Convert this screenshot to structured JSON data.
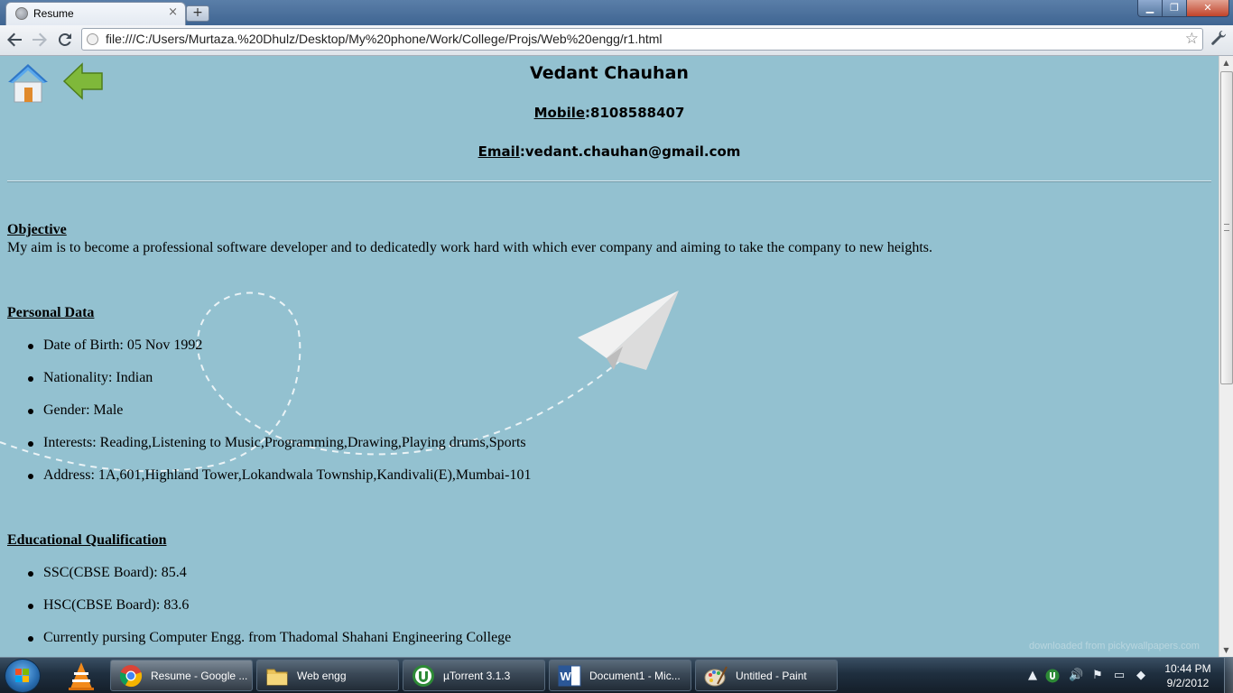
{
  "browser": {
    "tab_title": "Resume",
    "tab_close": "×",
    "new_tab": "+",
    "url": "file:///C:/Users/Murtaza.%20Dhulz/Desktop/My%20phone/Work/College/Projs/Web%20engg/r1.html",
    "window_buttons": {
      "minimize": "▁",
      "maximize": "❐",
      "close": "✕"
    }
  },
  "resume": {
    "name": "Vedant Chauhan",
    "mobile_label": "Mobile",
    "mobile_value": ":8108588407",
    "email_label": "Email",
    "email_value": ":vedant.chauhan@gmail.com",
    "objective_heading": "Objective",
    "objective_text": "My aim is to become a professional software developer and to dedicatedly work hard with which ever company and aiming to take the company to new heights.",
    "personal_heading": "Personal Data",
    "personal_items": [
      "Date of Birth: 05 Nov 1992",
      "Nationality: Indian",
      "Gender: Male",
      "Interests: Reading,Listening to Music,Programming,Drawing,Playing drums,Sports",
      "Address: 1A,601,Highland Tower,Lokandwala Township,Kandivali(E),Mumbai-101"
    ],
    "education_heading": "Educational Qualification",
    "education_items": [
      "SSC(CBSE Board): 85.4",
      "HSC(CBSE Board): 83.6",
      "Currently pursing Computer Engg. from Thadomal Shahani Engineering College"
    ],
    "watermark": "downloaded from pickywallpapers.com"
  },
  "taskbar": {
    "tasks": [
      {
        "label": "Resume - Google ...",
        "icon": "chrome-icon"
      },
      {
        "label": "Web engg",
        "icon": "folder-icon"
      },
      {
        "label": "µTorrent 3.1.3",
        "icon": "utorrent-icon"
      },
      {
        "label": "Document1 - Mic...",
        "icon": "word-icon"
      },
      {
        "label": "Untitled - Paint",
        "icon": "paint-icon"
      }
    ],
    "clock_time": "10:44 PM",
    "clock_date": "9/2/2012"
  },
  "colors": {
    "page_background": "#93c1d0",
    "accent": "#3f6592"
  }
}
